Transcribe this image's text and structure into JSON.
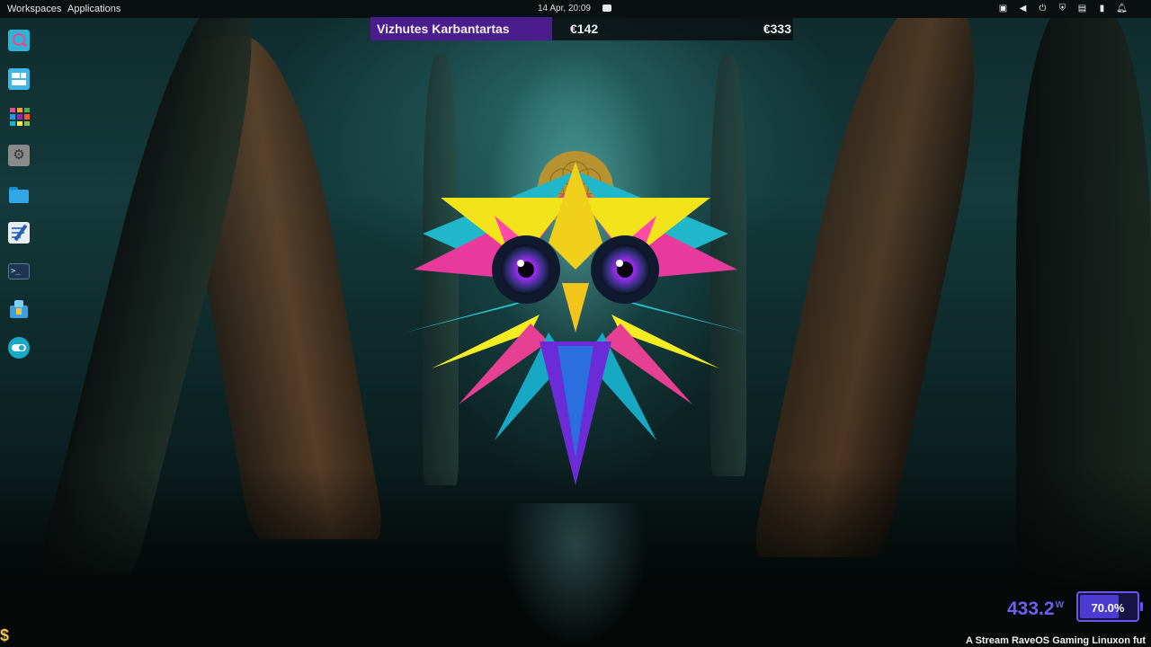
{
  "topbar": {
    "workspaces_label": "Workspaces",
    "applications_label": "Applications",
    "clock": "14 Apr, 20:09"
  },
  "ticker": {
    "name": "Vizhutes Karbantartas",
    "value_1": "€142",
    "value_2": "€333"
  },
  "dock": {
    "items": [
      {
        "icon": "search-app-icon",
        "color": "#2bb5d8"
      },
      {
        "icon": "window-manager-icon",
        "color": "#3fb6e8"
      },
      {
        "icon": "app-grid-icon",
        "color": "#e94b8a"
      },
      {
        "icon": "settings-icon",
        "color": "#8a8a8a"
      },
      {
        "icon": "folder-icon",
        "color": "#2fa6e6"
      },
      {
        "icon": "text-editor-icon",
        "color": "#3d7fd6"
      },
      {
        "icon": "terminal-icon",
        "color": "#1d3550"
      },
      {
        "icon": "software-store-icon",
        "color": "#3aa0e0"
      },
      {
        "icon": "toggle-app-icon",
        "color": "#18a8c8"
      }
    ]
  },
  "widgets": {
    "power_value": "433.2",
    "power_unit": "W",
    "battery_label": "70.0%",
    "battery_level": 0.7,
    "marquee": "A Stream RaveOS Gaming Linuxon fut"
  },
  "theme": {
    "accent": "#6a55e8",
    "ticker_accent": "#4a1c8c"
  }
}
